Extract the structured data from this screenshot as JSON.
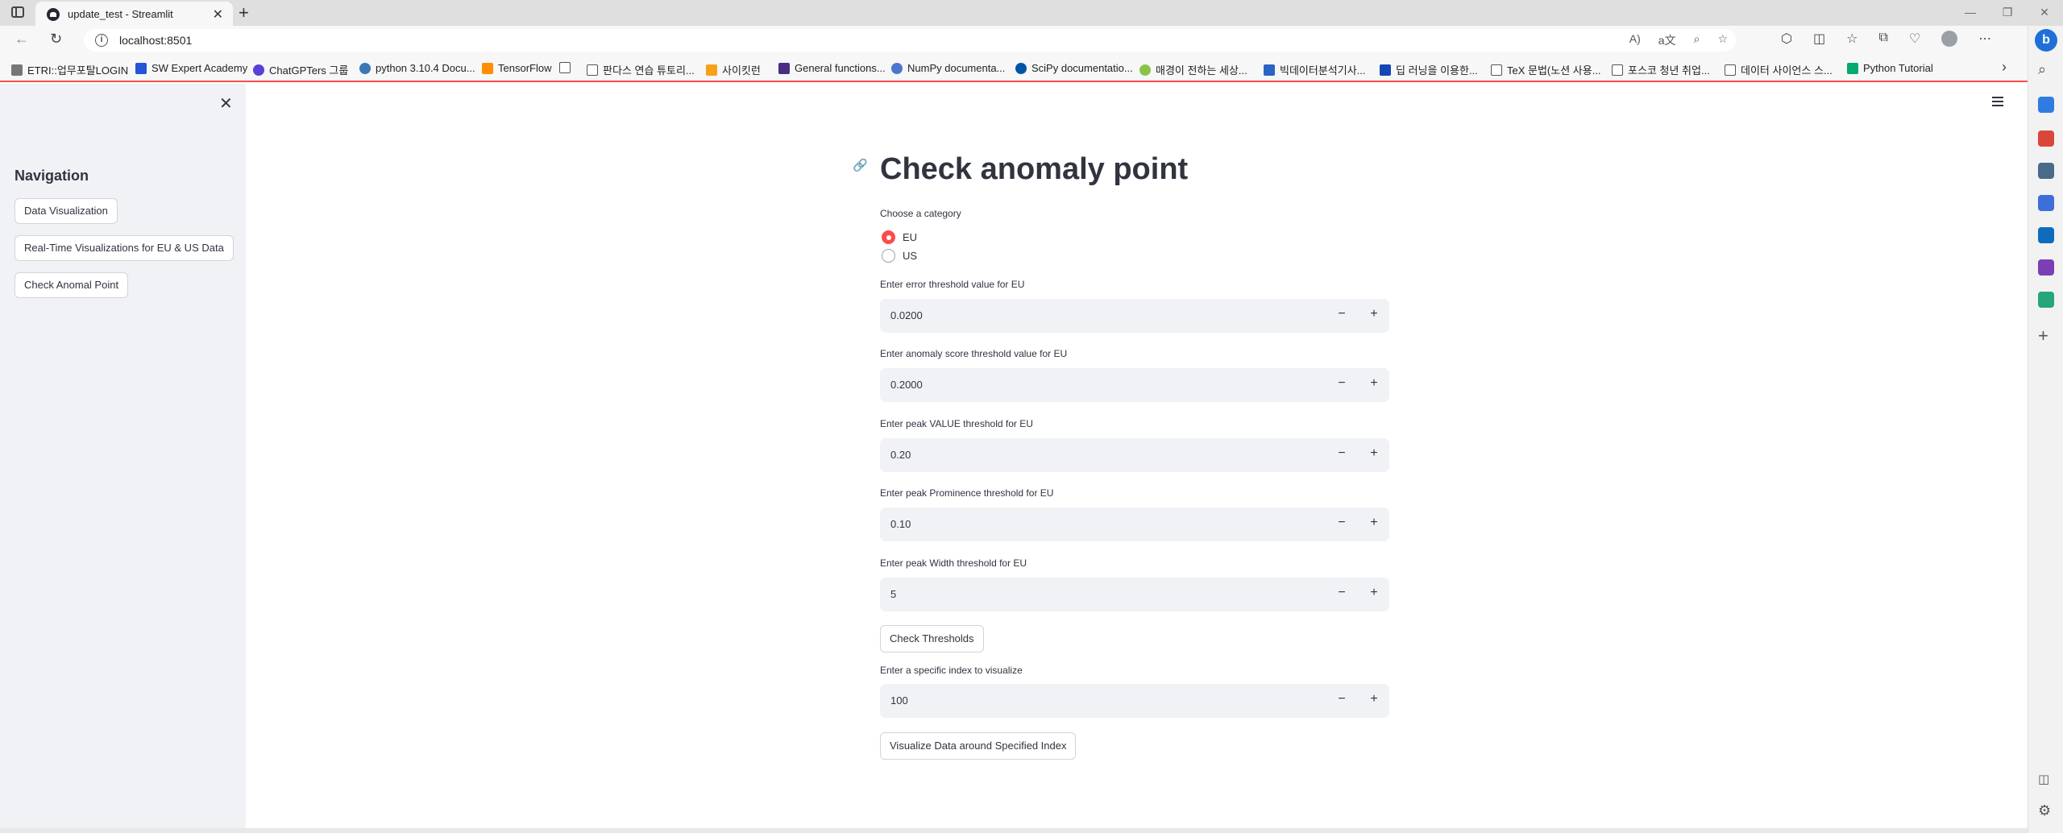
{
  "browser": {
    "tab_title": "update_test - Streamlit",
    "url": "localhost:8501",
    "bookmarks": [
      "ETRI::업무포탈LOGIN",
      "SW Expert Academy",
      "ChatGPTers 그룹",
      "python 3.10.4 Docu...",
      "TensorFlow",
      "",
      "판다스 연습 튜토리...",
      "사이킷런",
      "General functions...",
      "NumPy documenta...",
      "SciPy documentatio...",
      "매경이 전하는 세상...",
      "빅데이터분석기사...",
      "딥 러닝을 이용한...",
      "TeX 문법(노션 사용...",
      "포스코 청년 취업...",
      "데이터 사이언스 스...",
      "Python Tutorial"
    ]
  },
  "sidebar": {
    "heading": "Navigation",
    "buttons": [
      "Data Visualization",
      "Real-Time Visualizations for EU & US Data",
      "Check Anomal Point"
    ]
  },
  "main": {
    "title": "Check anomaly point",
    "category_label": "Choose a category",
    "category_options": [
      "EU",
      "US"
    ],
    "selected_category": "EU",
    "inputs": [
      {
        "label": "Enter error threshold value for EU",
        "value": "0.0200"
      },
      {
        "label": "Enter anomaly score threshold value for EU",
        "value": "0.2000"
      },
      {
        "label": "Enter peak VALUE threshold for EU",
        "value": "0.20"
      },
      {
        "label": "Enter peak Prominence threshold for EU",
        "value": "0.10"
      },
      {
        "label": "Enter peak Width threshold for EU",
        "value": "5"
      }
    ],
    "check_button": "Check Thresholds",
    "index_input": {
      "label": "Enter a specific index to visualize",
      "value": "100"
    },
    "visualize_button": "Visualize Data around Specified Index",
    "minus_symbol": "−",
    "plus_symbol": "+"
  },
  "colors": {
    "accent": "#ff4b4b",
    "sidebar_bg": "#f0f2f6",
    "input_bg": "#f0f2f6",
    "text": "#31333f"
  }
}
